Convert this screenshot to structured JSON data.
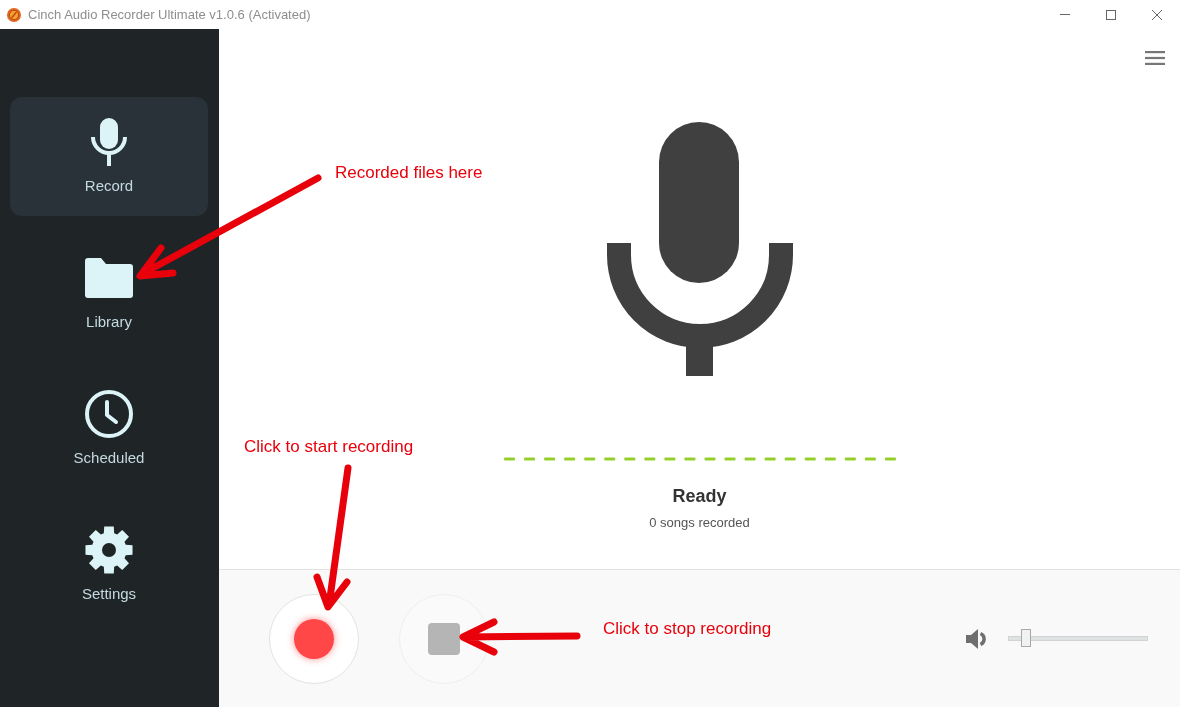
{
  "window": {
    "title": "Cinch Audio Recorder Ultimate v1.0.6 (Activated)"
  },
  "sidebar": {
    "items": [
      {
        "label": "Record",
        "selected": true
      },
      {
        "label": "Library",
        "selected": false
      },
      {
        "label": "Scheduled",
        "selected": false
      },
      {
        "label": "Settings",
        "selected": false
      }
    ]
  },
  "status": {
    "title": "Ready",
    "detail": "0 songs recorded"
  },
  "volume": {
    "level": 0.1
  },
  "annotations": [
    {
      "text": "Recorded files here"
    },
    {
      "text": "Click to start recording"
    },
    {
      "text": "Click to stop recording"
    }
  ]
}
